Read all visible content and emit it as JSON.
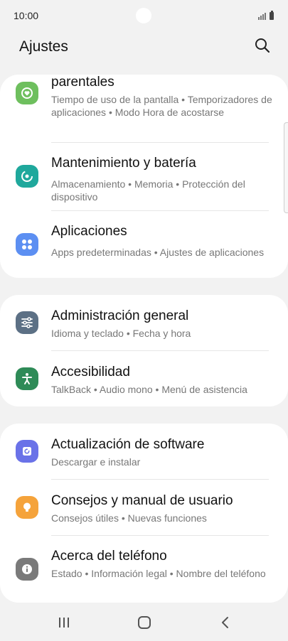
{
  "status_bar": {
    "time": "10:00"
  },
  "header": {
    "title": "Ajustes",
    "search_icon": "search-icon"
  },
  "card1": {
    "items": [
      {
        "title": "parentales",
        "subtitle": "Tiempo de uso de la pantalla  •  Temporizadores de aplicaciones  •  Modo Hora de acostarse",
        "icon": "heart-time-icon",
        "color": "#6ebf5e"
      },
      {
        "title": "Mantenimiento y batería",
        "subtitle": "Almacenamiento  •  Memoria  •  Protección del dispositivo",
        "icon": "maintenance-icon",
        "color": "#1fa89c"
      },
      {
        "title": "Aplicaciones",
        "subtitle": "Apps predeterminadas  •  Ajustes de aplicaciones",
        "icon": "apps-icon",
        "color": "#5c8ff2"
      }
    ]
  },
  "card2": {
    "items": [
      {
        "title": "Administración general",
        "subtitle": "Idioma y teclado  •  Fecha y hora",
        "icon": "sliders-icon",
        "color": "#5c7085"
      },
      {
        "title": "Accesibilidad",
        "subtitle": "TalkBack  •  Audio mono  •  Menú de asistencia",
        "icon": "accessibility-icon",
        "color": "#2e8b57"
      }
    ]
  },
  "card3": {
    "items": [
      {
        "title": "Actualización de software",
        "subtitle": "Descargar e instalar",
        "icon": "software-update-icon",
        "color": "#6a72e8"
      },
      {
        "title": "Consejos y manual de usuario",
        "subtitle": "Consejos útiles  •  Nuevas funciones",
        "icon": "lightbulb-icon",
        "color": "#f5a33b"
      },
      {
        "title": "Acerca del teléfono",
        "subtitle": "Estado  •  Información legal  •  Nombre del teléfono",
        "icon": "info-icon",
        "color": "#7a7a7a"
      }
    ]
  },
  "nav_bar": {
    "recents_icon": "recents-icon",
    "home_icon": "home-icon",
    "back_icon": "back-icon"
  }
}
